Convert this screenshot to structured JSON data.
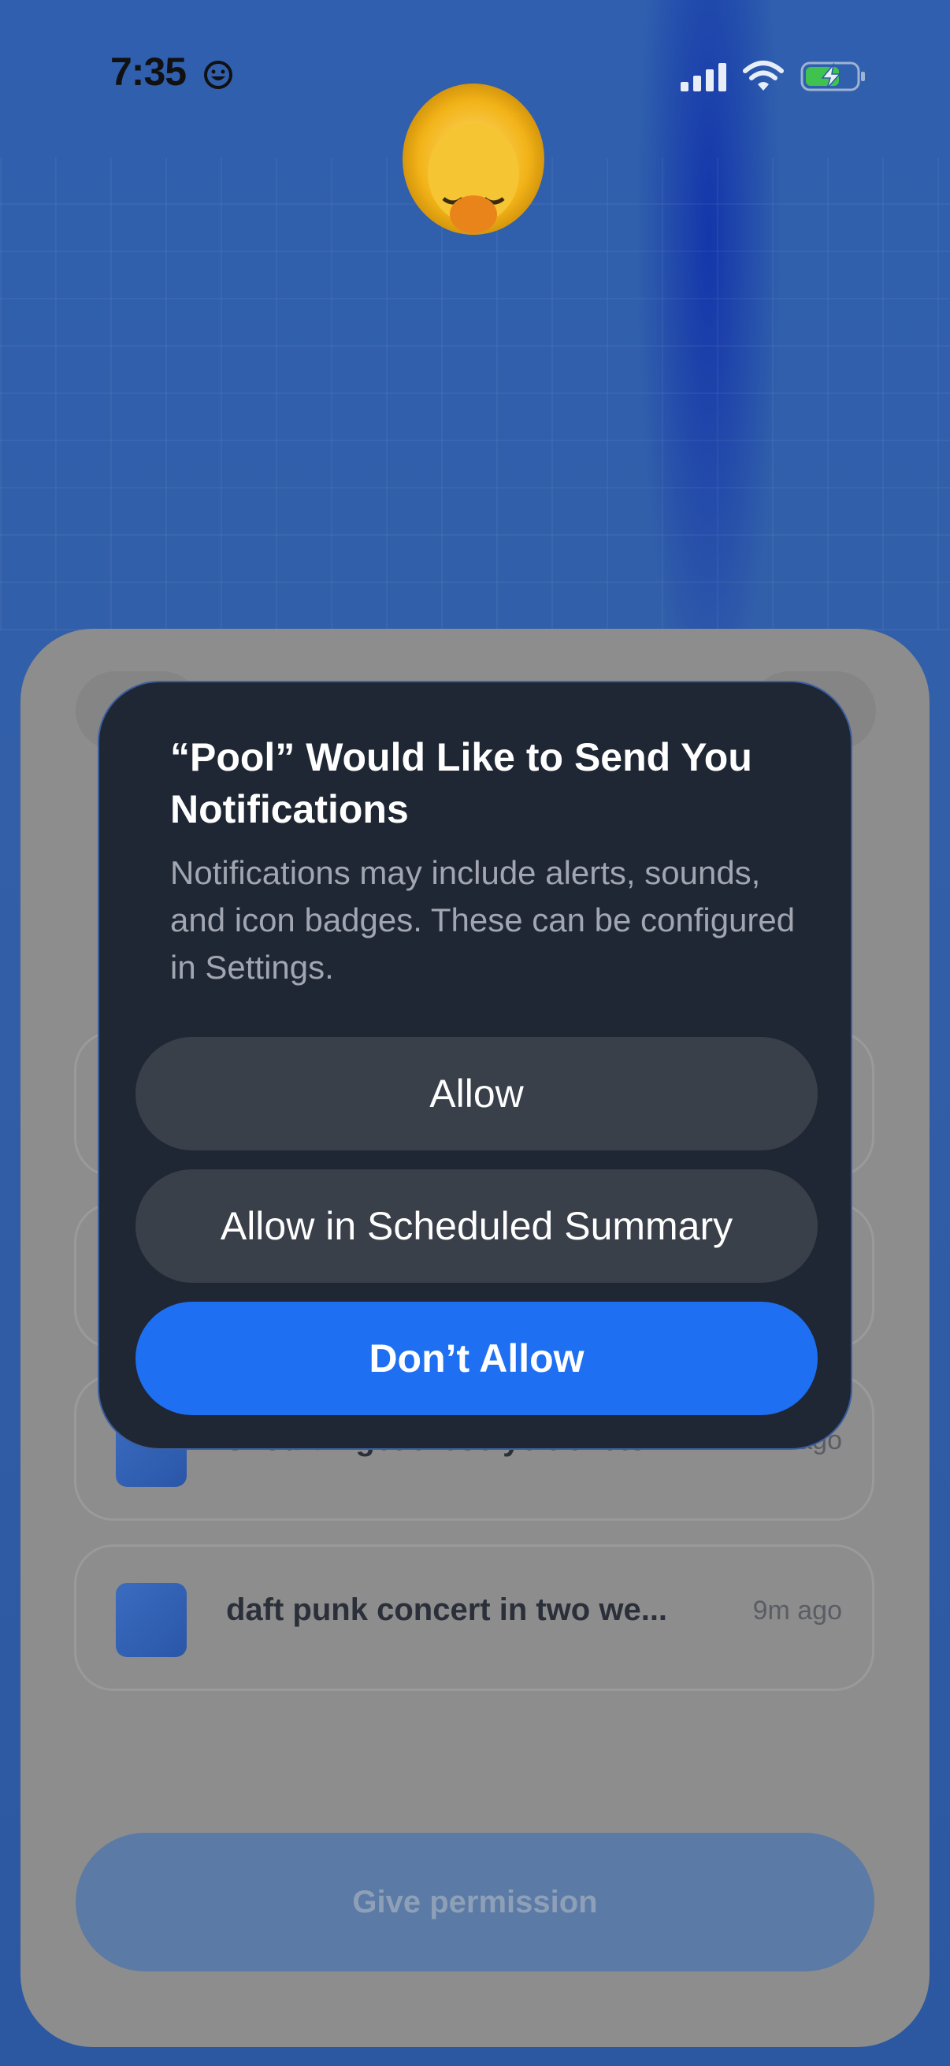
{
  "status_bar": {
    "time": "7:35"
  },
  "alert": {
    "title": "“Pool” Would Like to Send You Notifications",
    "message": "Notifications may include alerts, sounds, and icon badges. These can be configured in Settings.",
    "allow_label": "Allow",
    "scheduled_label": "Allow in Scheduled Summary",
    "dont_allow_label": "Don’t Allow"
  },
  "background_list": {
    "items": [
      {
        "text": "should i get these ye tickets?",
        "time": "7m ago"
      },
      {
        "text": "daft punk concert in two we...",
        "time": "9m ago"
      }
    ]
  },
  "give_permission_label": "Give permission",
  "colors": {
    "primary_blue": "#1e6ff2",
    "alert_bg": "#1f2735",
    "button_gray": "#3a404a"
  }
}
